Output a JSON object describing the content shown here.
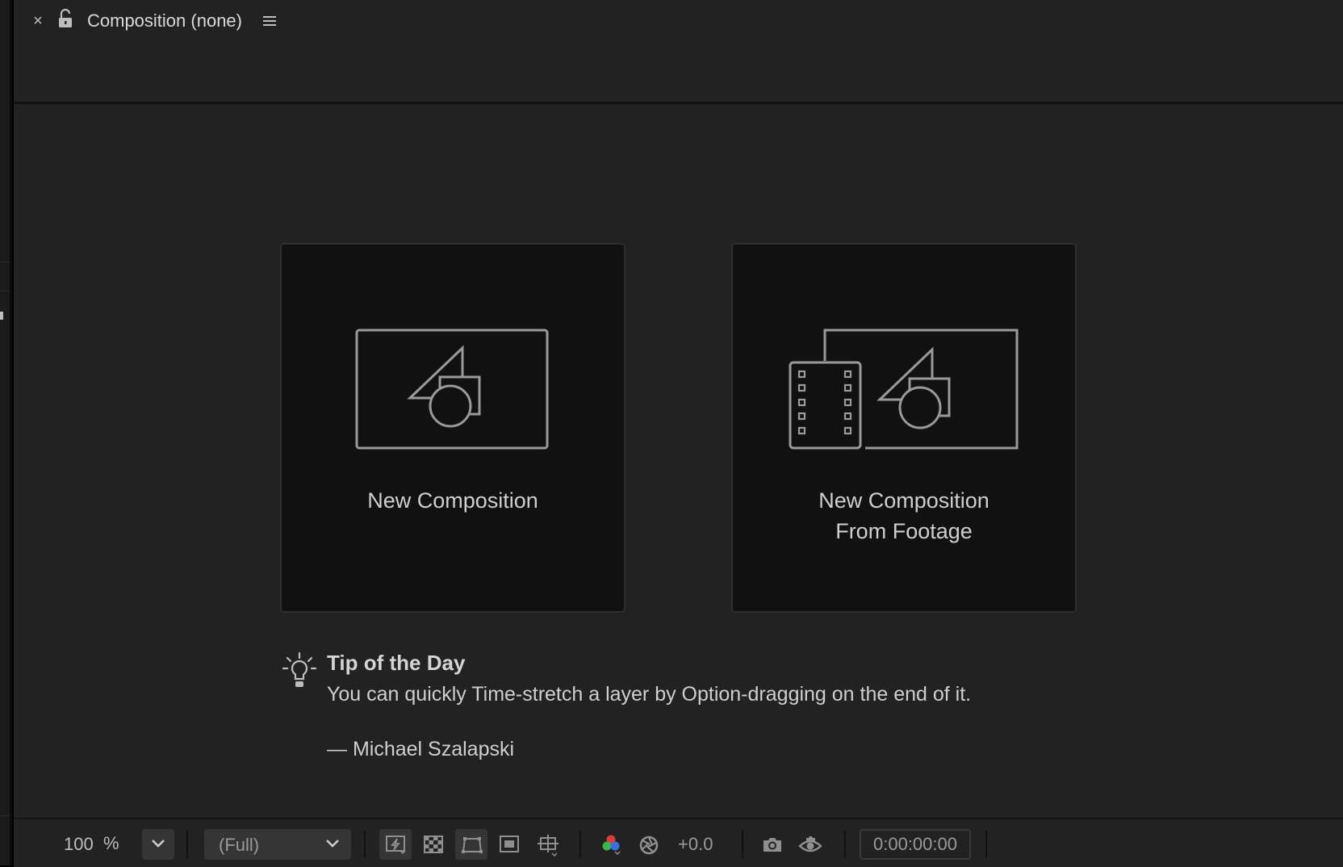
{
  "panel": {
    "tab_title": "Composition (none)",
    "close_icon": "close-icon",
    "lock_icon": "unlock-icon",
    "menu_icon": "hamburger-menu-icon"
  },
  "cards": [
    {
      "label": "New Composition",
      "icon": "composition-shapes-icon"
    },
    {
      "label_line1": "New Composition",
      "label_line2": "From Footage",
      "icon": "footage-film-icon"
    }
  ],
  "tip": {
    "title": "Tip of the Day",
    "body": "You can quickly Time-stretch a layer by Option-dragging on the end of it.",
    "author": "— Michael Szalapski",
    "icon": "lightbulb-icon"
  },
  "toolbar": {
    "zoom_value": "100",
    "zoom_unit": "%",
    "resolution": "(Full)",
    "exposure": "+0.0",
    "timecode": "0:00:00:00"
  },
  "colors": {
    "background": "#222222",
    "card": "#111111",
    "card_border": "#2e2e2e",
    "text": "#cfcfcf",
    "icon_stroke": "#9a9a9a"
  }
}
